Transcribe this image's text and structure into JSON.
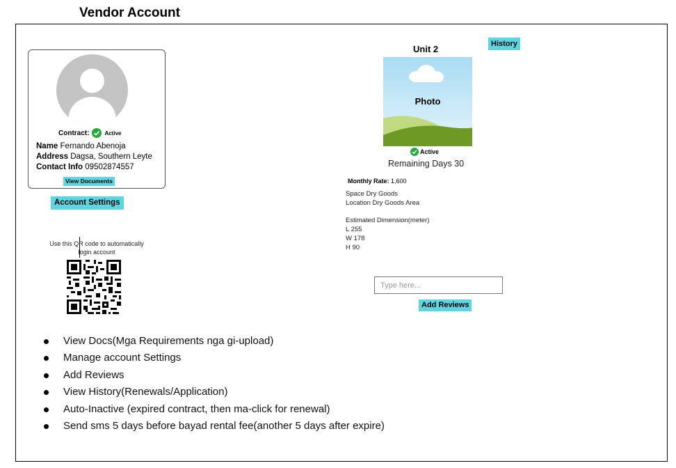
{
  "page": {
    "title": "Vendor Account"
  },
  "profile": {
    "contract_label": "Contract:",
    "contract_status": "Active",
    "name_label": "Name",
    "name_value": "Fernando Abenoja",
    "address_label": "Address",
    "address_value": "Dagsa, Southern Leyte",
    "contact_label": "Contact Info",
    "contact_value": "09502874557",
    "view_documents_label": "View Documents",
    "account_settings_label": "Account Settings"
  },
  "qr": {
    "caption_line1": "Use this QR code to automatically",
    "caption_line2": "login account"
  },
  "unit": {
    "title": "Unit 2",
    "history_label": "History",
    "photo_label": "Photo",
    "status": "Active",
    "remaining_days": "Remaining Days 30",
    "monthly_rate_label": "Monthly Rate",
    "monthly_rate_value": "1,600",
    "space": "Space Dry Goods",
    "location": "Location Dry Goods Area",
    "dimension_heading": "Estimated Dimension(meter)",
    "length": "L 255",
    "width": "W 178",
    "height": "H 90"
  },
  "review": {
    "placeholder": "Type here...",
    "add_reviews_label": "Add Reviews"
  },
  "notes": [
    "View Docs(Mga Requirements nga gi-upload)",
    "Manage account Settings",
    "Add Reviews",
    "View History(Renewals/Application)",
    "Auto-Inactive (expired contract, then ma-click for renewal)",
    "Send sms 5 days before bayad rental fee(another 5 days after expire)"
  ],
  "colors": {
    "accent_button": "#5ad7e0",
    "active_green": "#1faa3a"
  }
}
